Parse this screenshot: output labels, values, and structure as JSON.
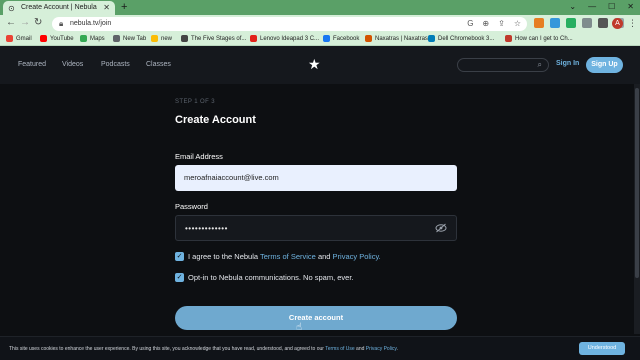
{
  "browser": {
    "tab_title": "Create Account | Nebula",
    "url": "nebula.tv/join",
    "profile_initial": "A",
    "bookmarks": [
      {
        "label": "Gmail",
        "color": "#ea4335"
      },
      {
        "label": "YouTube",
        "color": "#ff0000"
      },
      {
        "label": "Maps",
        "color": "#34a853"
      },
      {
        "label": "New Tab",
        "color": "#5f6368"
      },
      {
        "label": "new",
        "color": "#fbbc04"
      },
      {
        "label": "The Five Stages of...",
        "color": "#444444"
      },
      {
        "label": "Lenovo Ideapad 3 C...",
        "color": "#e2231a"
      },
      {
        "label": "Facebook",
        "color": "#1877f2"
      },
      {
        "label": "Naxatras | Naxatras",
        "color": "#d35400"
      },
      {
        "label": "Dell Chromebook 3...",
        "color": "#007db8"
      },
      {
        "label": "How can I get to Ch...",
        "color": "#c0392b"
      }
    ]
  },
  "nav": {
    "links": [
      "Featured",
      "Videos",
      "Podcasts",
      "Classes"
    ],
    "sign_in": "Sign In",
    "sign_up": "Sign Up"
  },
  "form": {
    "step": "STEP 1 OF 3",
    "title": "Create Account",
    "email_label": "Email Address",
    "email_value": "meroafnaiaccount@live.com",
    "password_label": "Password",
    "password_value": "•••••••••••••",
    "agree_prefix": "I agree to the Nebula ",
    "terms_link": "Terms of Service",
    "agree_and": " and ",
    "privacy_link": "Privacy Policy.",
    "optin_text": "Opt-in to Nebula communications. No spam, ever.",
    "submit_label": "Create account"
  },
  "cookie": {
    "text": "This site uses cookies to enhance the user experience. By using this site, you acknowledge that you have read, understood, and agreed to our ",
    "terms_link": "Terms of Use",
    "and": " and ",
    "privacy_link": "Privacy Policy",
    "end": ".",
    "button": "Understood"
  },
  "colors": {
    "accent": "#6fb3e0",
    "background": "#0d0f12",
    "browser_frame": "#5aa067"
  }
}
